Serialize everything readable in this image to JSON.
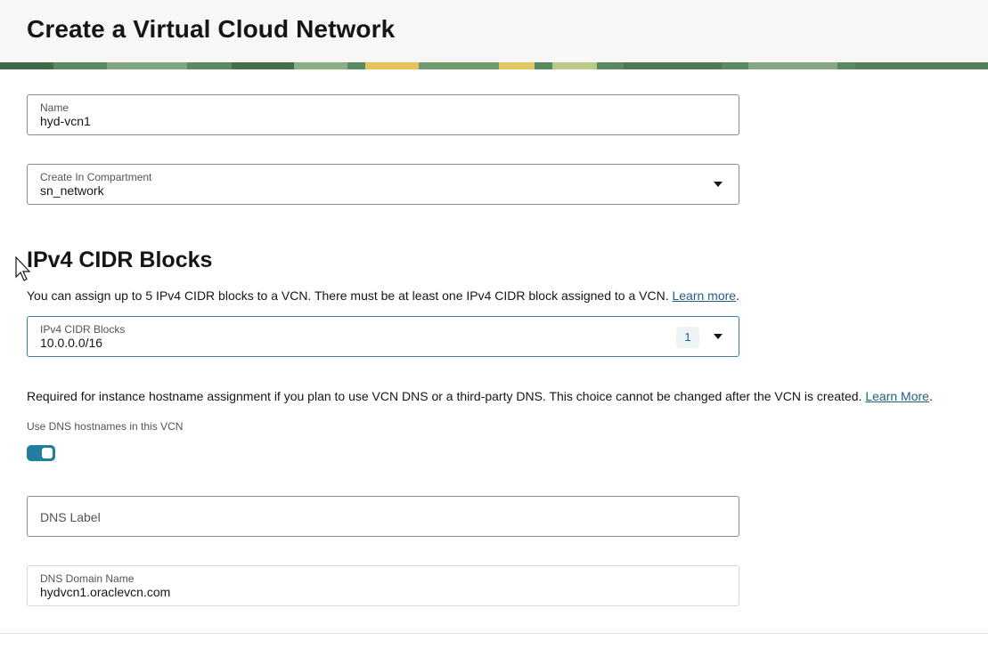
{
  "page": {
    "title": "Create a Virtual Cloud Network"
  },
  "name_field": {
    "label": "Name",
    "value": "hyd-vcn1"
  },
  "compartment_field": {
    "label": "Create In Compartment",
    "value": "sn_network",
    "icon": "chevron-down-icon"
  },
  "cidr_section": {
    "title": "IPv4 CIDR Blocks",
    "help": "You can assign up to 5 IPv4 CIDR blocks to a VCN. There must be at least one IPv4 CIDR block assigned to a VCN. ",
    "help_link": "Learn more",
    "help_suffix": ".",
    "field_label": "IPv4 CIDR Blocks",
    "field_value": "10.0.0.0/16",
    "count": "1"
  },
  "dns": {
    "help": "Required for instance hostname assignment if you plan to use VCN DNS or a third-party DNS. This choice cannot be changed after the VCN is created. ",
    "help_link": "Learn More",
    "help_suffix": ".",
    "toggle_label": "Use DNS hostnames in this VCN",
    "toggle_on": true,
    "dns_label_placeholder": "DNS Label",
    "domain_label": "DNS Domain Name",
    "domain_value": "hydvcn1.oraclevcn.com"
  },
  "colors": {
    "accent": "#227e9e",
    "link": "#1f5f80",
    "header_bg": "#f8f7f5"
  }
}
